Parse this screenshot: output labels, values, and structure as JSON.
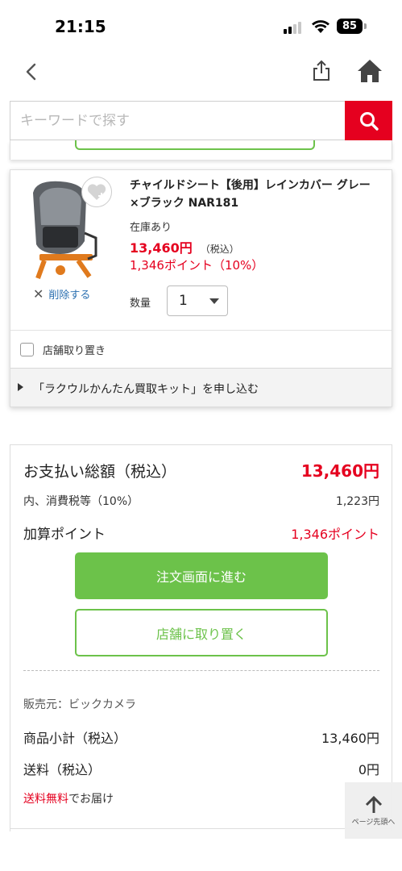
{
  "status_bar": {
    "time": "21:15",
    "battery": "85"
  },
  "search": {
    "placeholder": "キーワードで探す"
  },
  "product": {
    "name": "チャイルドシート【後用】レインカバー グレー×ブラック NAR181",
    "stock": "在庫あり",
    "price": "13,460円",
    "tax_note": "（税込）",
    "points": "1,346ポイント（10%）",
    "delete_label": "削除する",
    "qty_label": "数量",
    "qty_value": "1",
    "store_pickup_label": "店舗取り置き",
    "kit_label": "「ラクウルかんたん買取キット」を申し込む"
  },
  "summary": {
    "total_label": "お支払い総額（税込）",
    "total_value": "13,460円",
    "tax_label": "内、消費税等（10%）",
    "tax_value": "1,223円",
    "points_label": "加算ポイント",
    "points_value": "1,346ポイント",
    "order_button": "注文画面に進む",
    "store_button": "店舗に取り置く",
    "seller": "販売元：ビックカメラ",
    "subtotal_label": "商品小計（税込）",
    "subtotal_value": "13,460円",
    "shipping_label": "送料（税込）",
    "shipping_value": "0円",
    "free_shipping": "送料無料",
    "free_shipping_suffix": "でお届け"
  },
  "page_top": {
    "label": "ページ先頭へ"
  },
  "colors": {
    "brand_red": "#e5001f",
    "accent_green": "#6cc24a",
    "link_blue": "#2a6fb0"
  },
  "icons": [
    "back-arrow-icon",
    "share-icon",
    "home-icon",
    "search-icon",
    "favorite-heart-icon",
    "close-icon",
    "chevron-down-icon",
    "arrow-up-icon"
  ]
}
